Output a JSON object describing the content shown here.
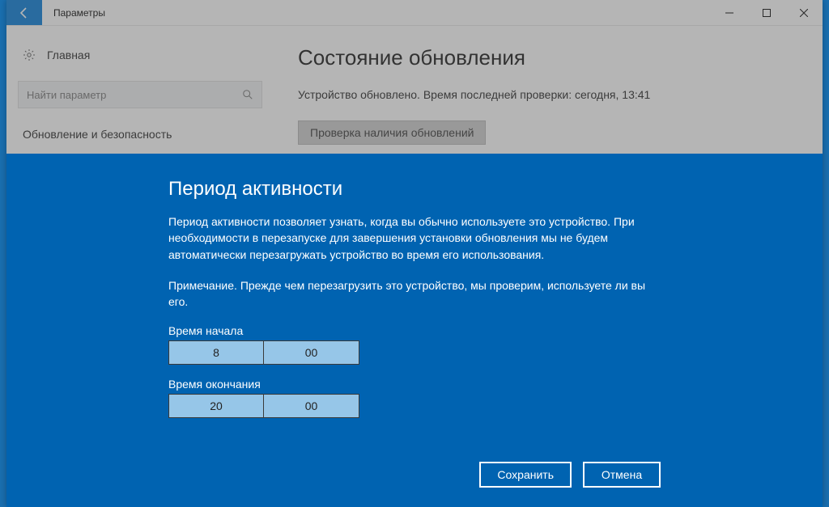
{
  "titlebar": {
    "title": "Параметры"
  },
  "sidebar": {
    "home_label": "Главная",
    "search_placeholder": "Найти параметр",
    "category_label": "Обновление и безопасность"
  },
  "main": {
    "heading": "Состояние обновления",
    "status_text": "Устройство обновлено. Время последней проверки: сегодня, 13:41",
    "check_button_label": "Проверка наличия обновлений"
  },
  "dialog": {
    "title": "Период активности",
    "body1": "Период активности позволяет узнать, когда вы обычно используете это устройство. При необходимости в перезапуске для завершения установки обновления мы не будем автоматически перезагружать устройство во время его использования.",
    "body2": "Примечание. Прежде чем перезагрузить это устройство, мы проверим, используете ли вы его.",
    "start_label": "Время начала",
    "start_hour": "8",
    "start_minute": "00",
    "end_label": "Время окончания",
    "end_hour": "20",
    "end_minute": "00",
    "save_label": "Сохранить",
    "cancel_label": "Отмена"
  }
}
